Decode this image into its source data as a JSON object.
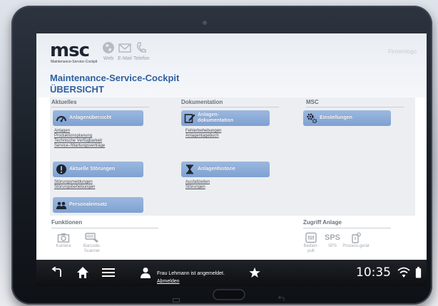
{
  "header": {
    "logo": "msc",
    "logo_subtitle": "Maintenance-Service-Cockpit",
    "links": [
      {
        "label": "Web",
        "icon": "globe-icon"
      },
      {
        "label": "E-Mail",
        "icon": "mail-icon"
      },
      {
        "label": "Telefon",
        "icon": "phone-icon"
      }
    ],
    "firmenlogo": "Firmenlogo",
    "title": "Maintenance-Service-Cockpit",
    "subtitle": "ÜBERSICHT"
  },
  "sections": {
    "aktuelles": {
      "heading": "Aktuelles",
      "tiles": [
        {
          "label": "Anlagenübersicht",
          "icon": "gauge-icon",
          "links": [
            "Anlagen",
            "Produktionsplanung",
            "Technische Verfügbarkeit",
            "Service-/Wartungsverträge"
          ]
        },
        {
          "label": "Aktuelle Störungen",
          "icon": "alert-icon",
          "links": [
            "Störungsmeldungen",
            "Störungsbehebungen"
          ]
        },
        {
          "label": "Personaleinsatz",
          "icon": "people-icon",
          "links": []
        }
      ]
    },
    "dokumentation": {
      "heading": "Dokumentation",
      "tiles": [
        {
          "label": "Anlagen-\ndokumentation",
          "icon": "edit-icon",
          "links": [
            "Fehlerbehebungen",
            "Anlagentagebuch"
          ]
        },
        {
          "label": "Anlagenhistorie",
          "icon": "hourglass-icon",
          "links": [
            "Ausfallzeiten",
            "Störungen"
          ]
        }
      ]
    },
    "msc": {
      "heading": "MSC",
      "tiles": [
        {
          "label": "Einstellungen",
          "icon": "gears-icon",
          "links": []
        }
      ]
    }
  },
  "funktionen": {
    "heading": "Funktionen",
    "items": [
      {
        "label": "Kamera",
        "icon": "camera-icon"
      },
      {
        "label": "Barcode-\nScanner",
        "icon": "barcode-scanner-icon"
      }
    ]
  },
  "zugriff": {
    "heading": "Zugriff Anlage",
    "items": [
      {
        "label": "Bedien-\npult",
        "icon": "control-panel-icon"
      },
      {
        "label": "SPS",
        "icon": "sps-icon",
        "icon_text": "SPS"
      },
      {
        "label": "Prozess-gerät",
        "icon": "process-device-icon"
      }
    ]
  },
  "statusbar": {
    "user_text": "Frau Lehmann ist angemeldet.",
    "logout": "Abmelden",
    "time": "10:35"
  },
  "colors": {
    "accent": "#2f5f9e",
    "tile": "#8aaad7",
    "panel": "#eceef1",
    "bar": "#15181c"
  }
}
